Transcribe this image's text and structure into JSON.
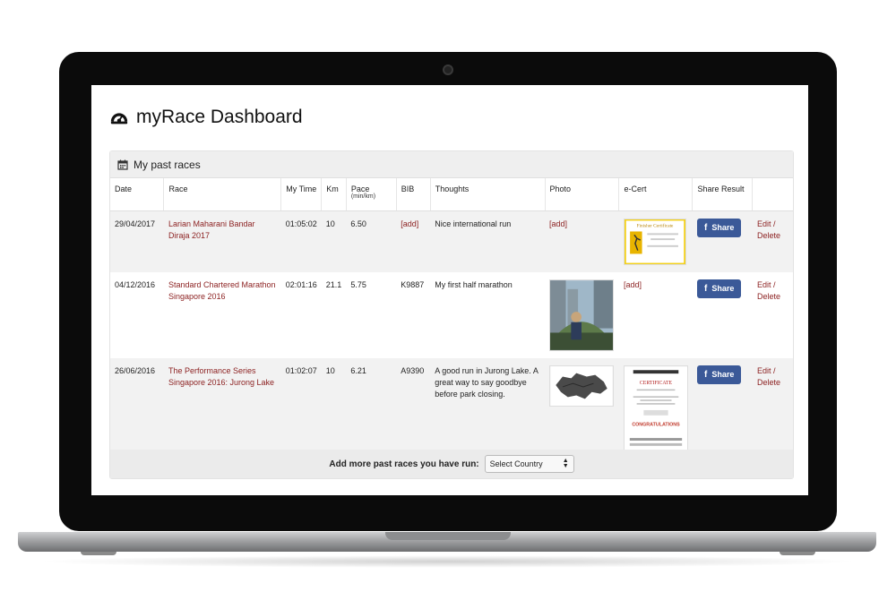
{
  "app": {
    "title": "myRace Dashboard",
    "icon": "dashboard-gauge-icon"
  },
  "panel": {
    "title": "My past races",
    "icon": "calendar-icon"
  },
  "columns": {
    "date": "Date",
    "race": "Race",
    "time": "My Time",
    "km": "Km",
    "pace": "Pace",
    "pace_unit": "(min/km)",
    "bib": "BIB",
    "thoughts": "Thoughts",
    "photo": "Photo",
    "ecert": "e-Cert",
    "share": "Share Result"
  },
  "rows": [
    {
      "date": "29/04/2017",
      "race": "Larian Maharani Bandar Diraja 2017",
      "time": "01:05:02",
      "km": "10",
      "pace": "6.50",
      "bib": "[add]",
      "thoughts": "Nice international run",
      "photo": "[add]",
      "ecert": "Finisher Certificate",
      "share": "Share",
      "edit": "Edit",
      "delete": "Delete"
    },
    {
      "date": "04/12/2016",
      "race": "Standard Chartered Marathon Singapore 2016",
      "time": "02:01:16",
      "km": "21.1",
      "pace": "5.75",
      "bib": "K9887",
      "thoughts": "My first half marathon",
      "photo": "",
      "ecert": "[add]",
      "share": "Share",
      "edit": "Edit",
      "delete": "Delete"
    },
    {
      "date": "26/06/2016",
      "race": "The Performance Series Singapore 2016: Jurong Lake",
      "time": "01:02:07",
      "km": "10",
      "pace": "6.21",
      "bib": "A9390",
      "thoughts": "A good run in Jurong Lake. A great way to say goodbye before park closing.",
      "photo": "",
      "ecert": "CERTIFICATE",
      "ecert_banner": "CONGRATULATIONS",
      "share": "Share",
      "edit": "Edit",
      "delete": "Delete"
    }
  ],
  "footer": {
    "label": "Add more past races you have run:",
    "select_value": "Select Country"
  },
  "colors": {
    "link": "#8b1f1f",
    "facebook": "#3b5998",
    "panel_head": "#efefef",
    "row_alt": "#f2f2f2"
  }
}
